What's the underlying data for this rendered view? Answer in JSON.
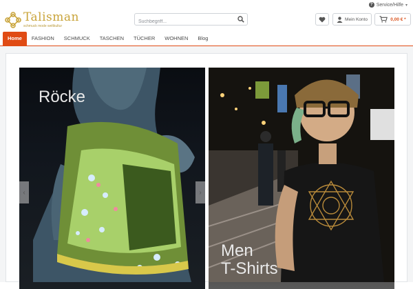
{
  "service": {
    "label": "Service/Hilfe"
  },
  "logo": {
    "name": "Talisman",
    "tagline": "schmuck mode weltkultur"
  },
  "search": {
    "placeholder": "Suchbegriff..."
  },
  "account": {
    "label": "Mein Konto"
  },
  "cart": {
    "amount": "0,00 € *"
  },
  "nav": {
    "items": [
      {
        "label": "Home"
      },
      {
        "label": "FASHION"
      },
      {
        "label": "SCHMUCK"
      },
      {
        "label": "TASCHEN"
      },
      {
        "label": "TÜCHER"
      },
      {
        "label": "WOHNEN"
      },
      {
        "label": "Blog"
      }
    ]
  },
  "banners": [
    {
      "title": "Röcke"
    },
    {
      "title_line1": "Men",
      "title_line2": "T-Shirts"
    }
  ],
  "colors": {
    "accent": "#e04b14",
    "gold": "#c9a43a",
    "price": "#d9531e"
  }
}
